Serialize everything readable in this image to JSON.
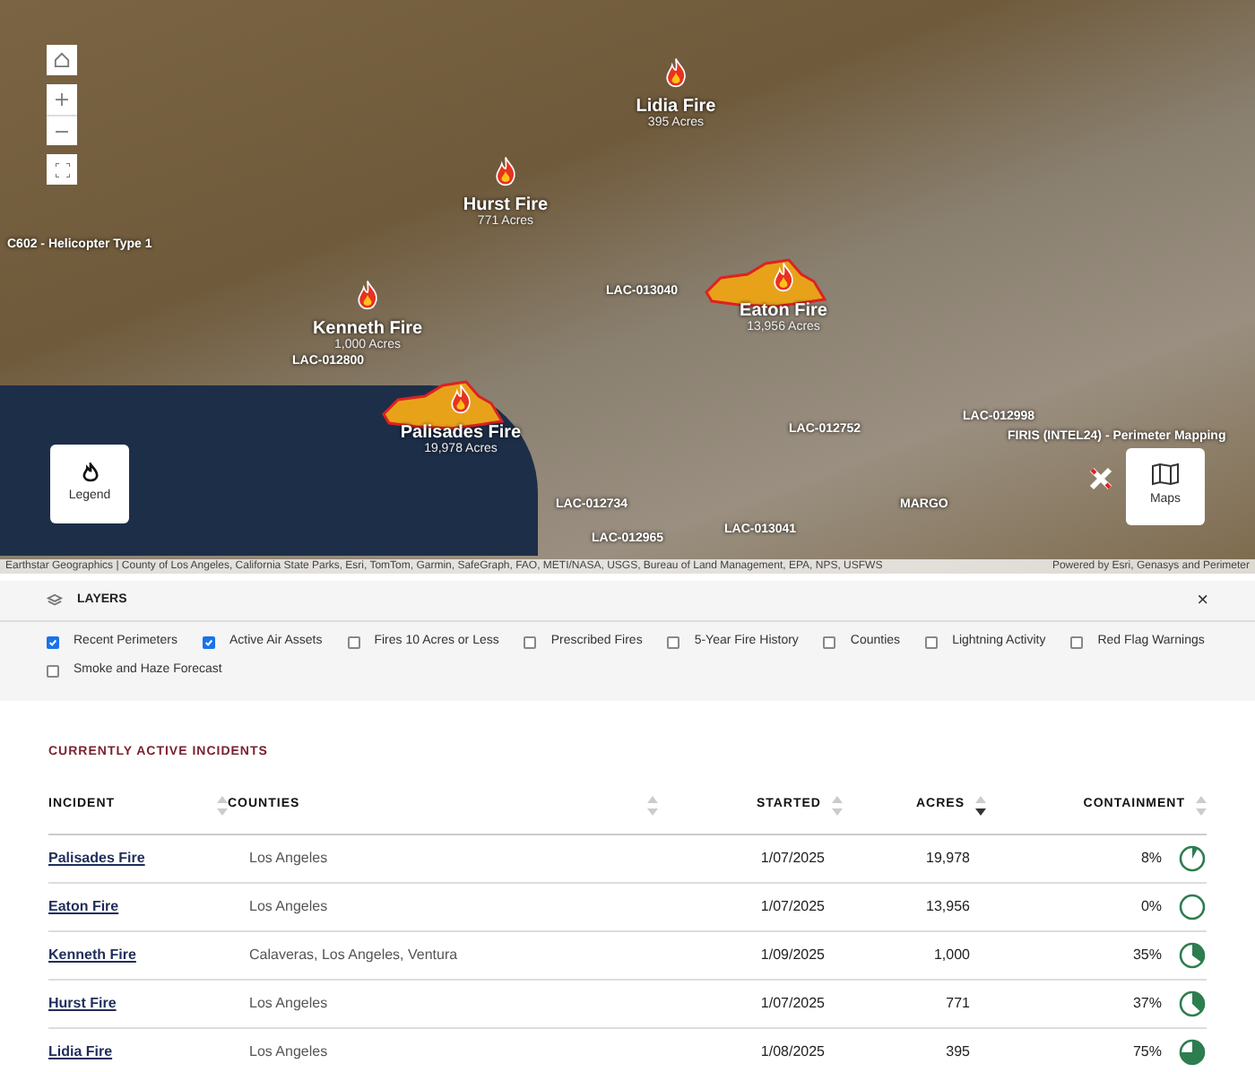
{
  "map": {
    "fires": [
      {
        "name": "Lidia Fire",
        "acres": "395 Acres",
        "perimeter": false
      },
      {
        "name": "Hurst Fire",
        "acres": "771 Acres",
        "perimeter": false
      },
      {
        "name": "Kenneth Fire",
        "acres": "1,000 Acres",
        "perimeter": false
      },
      {
        "name": "Eaton Fire",
        "acres": "13,956 Acres",
        "perimeter": true
      },
      {
        "name": "Palisades Fire",
        "acres": "19,978 Acres",
        "perimeter": true
      }
    ],
    "assets": [
      {
        "label": "C602 - Helicopter Type 1"
      },
      {
        "label": "LAC-012800"
      },
      {
        "label": "LAC-013040"
      },
      {
        "label": "LAC-012752"
      },
      {
        "label": "LAC-012998"
      },
      {
        "label": "FIRIS (INTEL24) - Perimeter Mapping"
      },
      {
        "label": "LAC-012734"
      },
      {
        "label": "LAC-013041"
      },
      {
        "label": "LAC-012965"
      },
      {
        "label": "MARGO"
      }
    ],
    "legend_button": "Legend",
    "maps_button": "Maps",
    "attribution": "Earthstar Geographics | County of Los Angeles, California State Parks, Esri, TomTom, Garmin, SafeGraph, FAO, METI/NASA, USGS, Bureau of Land Management, EPA, NPS, USFWS",
    "powered_by": "Powered by Esri, Genasys and Perimeter"
  },
  "layers": {
    "title": "LAYERS",
    "close": "×",
    "items": [
      {
        "label": "Recent Perimeters",
        "checked": true
      },
      {
        "label": "Active Air Assets",
        "checked": true
      },
      {
        "label": "Fires 10 Acres or Less",
        "checked": false
      },
      {
        "label": "Prescribed Fires",
        "checked": false
      },
      {
        "label": "5-Year Fire History",
        "checked": false
      },
      {
        "label": "Counties",
        "checked": false
      },
      {
        "label": "Lightning Activity",
        "checked": false
      },
      {
        "label": "Red Flag Warnings",
        "checked": false
      },
      {
        "label": "Smoke and Haze Forecast",
        "checked": false
      }
    ]
  },
  "incidents": {
    "title": "CURRENTLY ACTIVE INCIDENTS",
    "columns": [
      {
        "label": "INCIDENT",
        "sorted": false
      },
      {
        "label": "COUNTIES",
        "sorted": false
      },
      {
        "label": "STARTED",
        "sorted": false
      },
      {
        "label": "ACRES",
        "sorted": true
      },
      {
        "label": "CONTAINMENT",
        "sorted": false
      }
    ],
    "rows": [
      {
        "incident": "Palisades Fire",
        "counties": "Los Angeles",
        "started": "1/07/2025",
        "acres": "19,978",
        "containment": "8%"
      },
      {
        "incident": "Eaton Fire",
        "counties": "Los Angeles",
        "started": "1/07/2025",
        "acres": "13,956",
        "containment": "0%"
      },
      {
        "incident": "Kenneth Fire",
        "counties": "Calaveras, Los Angeles, Ventura",
        "started": "1/09/2025",
        "acres": "1,000",
        "containment": "35%"
      },
      {
        "incident": "Hurst Fire",
        "counties": "Los Angeles",
        "started": "1/07/2025",
        "acres": "771",
        "containment": "37%"
      },
      {
        "incident": "Lidia Fire",
        "counties": "Los Angeles",
        "started": "1/08/2025",
        "acres": "395",
        "containment": "75%"
      }
    ]
  }
}
